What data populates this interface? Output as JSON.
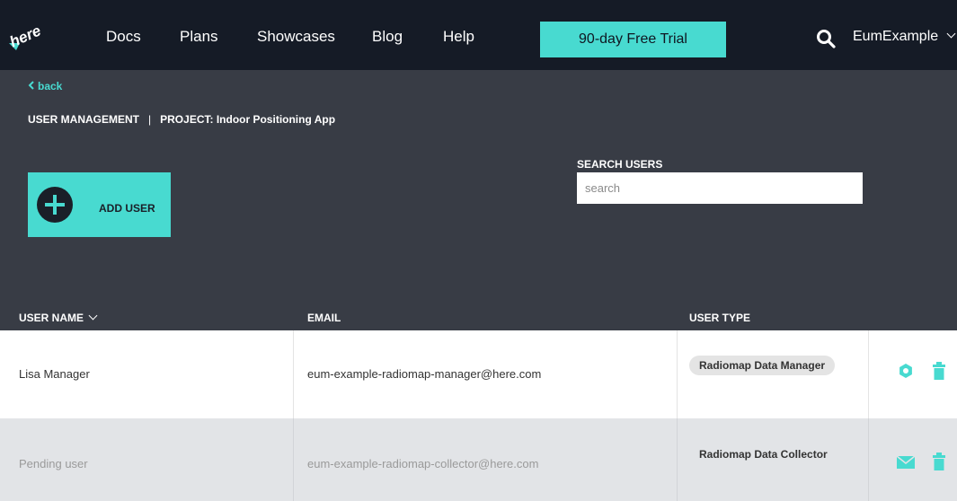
{
  "topbar": {
    "logo_text": "here",
    "nav": [
      "Docs",
      "Plans",
      "Showcases",
      "Blog",
      "Help"
    ],
    "trial_button": "90-day Free Trial",
    "account_name": "EumExample"
  },
  "header": {
    "back_label": "back",
    "section_title": "USER MANAGEMENT",
    "separator": "|",
    "project_label": "PROJECT: Indoor Positioning App",
    "add_user_label": "ADD USER",
    "search_label": "SEARCH USERS",
    "search_placeholder": "search"
  },
  "table": {
    "columns": [
      "USER NAME",
      "EMAIL",
      "USER TYPE"
    ],
    "sort_column": "USER NAME",
    "rows": [
      {
        "name": "Lisa Manager",
        "email": "eum-example-radiomap-manager@here.com",
        "user_type": "Radiomap Data Manager",
        "status": "active",
        "actions": [
          "gear-icon",
          "trash-icon"
        ]
      },
      {
        "name": "Pending user",
        "email": "eum-example-radiomap-collector@here.com",
        "user_type": "Radiomap Data Collector",
        "status": "pending",
        "actions": [
          "envelope-icon",
          "trash-icon"
        ]
      }
    ]
  },
  "colors": {
    "accent": "#48dad0",
    "topbar": "#151b26",
    "header_panel": "#383c45",
    "pending_row": "#e2e4e7"
  }
}
